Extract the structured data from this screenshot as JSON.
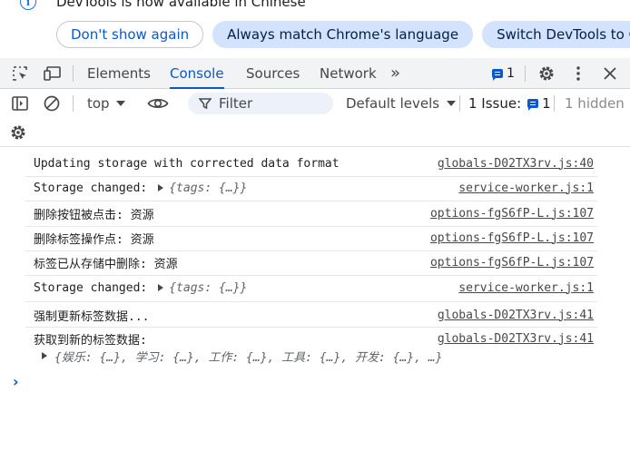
{
  "infobar": {
    "message": "DevTools is now available in Chinese",
    "buttons": [
      "Don't show again",
      "Always match Chrome's language",
      "Switch DevTools to Chinese"
    ]
  },
  "tabs": {
    "items": [
      "Elements",
      "Console",
      "Sources",
      "Network"
    ],
    "active": "Console",
    "more": "»",
    "message_count": "1"
  },
  "toolbar": {
    "context": "top",
    "filter_placeholder": "Filter",
    "levels": "Default levels",
    "issues_label": "1 Issue:",
    "issues_count": "1",
    "hidden": "1 hidden"
  },
  "messages": [
    {
      "text": "Updating storage with corrected data format",
      "object": "",
      "source": "globals-D02TX3rv.js:40"
    },
    {
      "text": "Storage changed:",
      "object": "{tags: {…}}",
      "source": "service-worker.js:1"
    },
    {
      "text": "删除按钮被点击: 资源",
      "object": "",
      "source": "options-fgS6fP-L.js:107"
    },
    {
      "text": "删除标签操作点: 资源",
      "object": "",
      "source": "options-fgS6fP-L.js:107"
    },
    {
      "text": "标签已从存储中删除: 资源",
      "object": "",
      "source": "options-fgS6fP-L.js:107"
    },
    {
      "text": "Storage changed:",
      "object": "{tags: {…}}",
      "source": "service-worker.js:1"
    },
    {
      "text": "强制更新标签数据...",
      "object": "",
      "source": "globals-D02TX3rv.js:41"
    },
    {
      "text": "获取到新的标签数据:",
      "object": "",
      "source": "globals-D02TX3rv.js:41"
    }
  ],
  "expanded_object": "{娱乐: {…}, 学习: {…}, 工作: {…}, 工具: {…}, 开发: {…},  …}",
  "prompt": "›",
  "colors": {
    "accent": "#0b57d0",
    "pill_fill": "#d3e3fd",
    "tab_bar": "#f1f3f4"
  }
}
